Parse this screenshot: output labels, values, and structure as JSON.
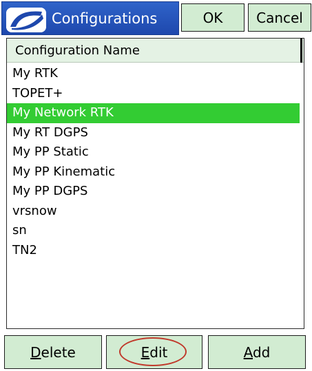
{
  "window": {
    "title": "Configurations",
    "logo_icon": "topcon-swoosh-logo-icon",
    "ok_label": "OK",
    "cancel_label": "Cancel"
  },
  "list": {
    "column_header": "Configuration Name",
    "items": [
      "My RTK",
      "TOPET+",
      "My Network RTK",
      "My RT DGPS",
      "My PP Static",
      "My PP Kinematic",
      "My PP DGPS",
      "vrsnow",
      "sn",
      "TN2"
    ],
    "selected_item": "My Network RTK"
  },
  "buttons": {
    "delete_first": "D",
    "delete_rest": "elete",
    "edit_first": "E",
    "edit_rest": "dit",
    "add_first": "A",
    "add_rest": "dd"
  },
  "colors": {
    "title_bar": "#2f63c9",
    "button_bg": "#d2ecd2",
    "selection": "#33cc33",
    "highlight_circle": "#c0392b"
  }
}
